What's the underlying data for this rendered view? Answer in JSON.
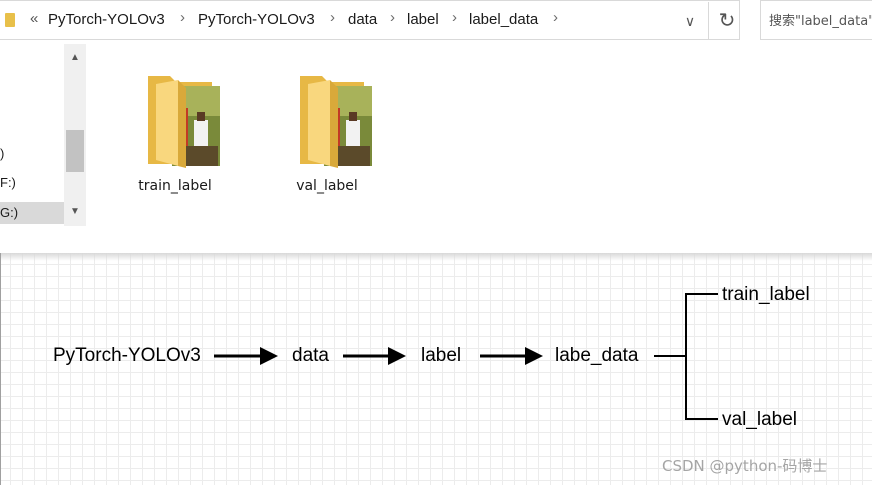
{
  "explorer": {
    "address_bar": {
      "overflow": "«",
      "breadcrumbs": [
        "PyTorch-YOLOv3",
        "PyTorch-YOLOv3",
        "data",
        "label",
        "label_data"
      ],
      "separator": "›",
      "dropdown": "∨",
      "refresh": "↻"
    },
    "search": {
      "placeholder": "搜索\"label_data\""
    },
    "nav_pane": {
      "items": [
        ")",
        "F:)",
        "G:)"
      ],
      "scroll_up": "▲",
      "scroll_down": "▼"
    },
    "folders": [
      {
        "name": "train_label",
        "icon": "folder-with-image-icon"
      },
      {
        "name": "val_label",
        "icon": "folder-with-image-icon"
      }
    ]
  },
  "diagram": {
    "nodes": {
      "root": "PyTorch-YOLOv3",
      "data": "data",
      "label": "label",
      "labe_data": "labe_data",
      "train_label": "train_label",
      "val_label": "val_label"
    }
  },
  "watermark": "CSDN @python-码博士",
  "colors": {
    "folder_yellow": "#f5c95a",
    "grid": "#ececec",
    "arrow": "#000000"
  }
}
